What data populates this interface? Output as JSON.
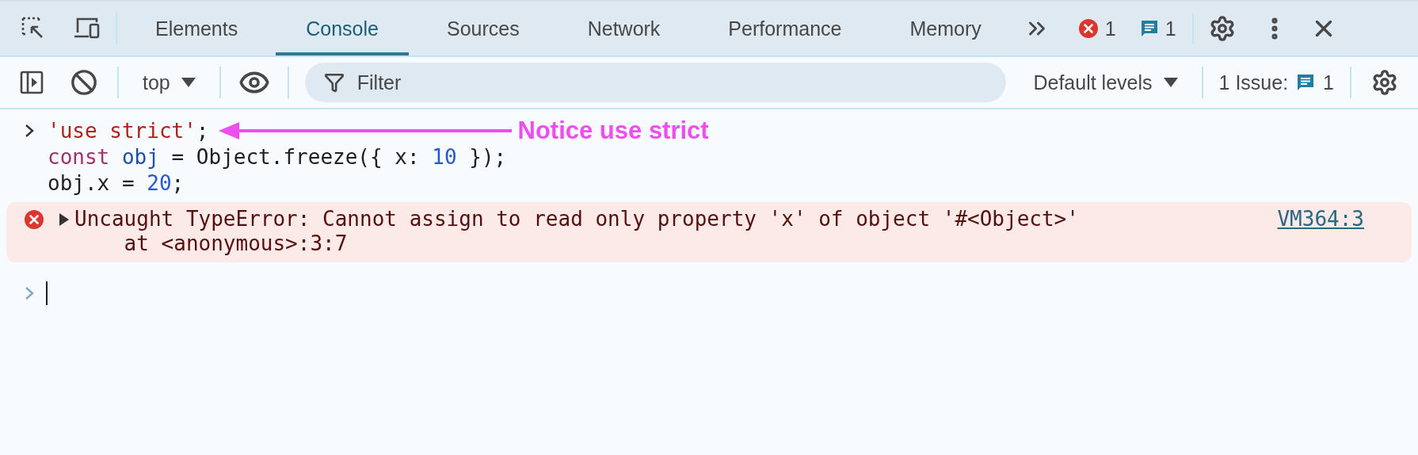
{
  "main_toolbar": {
    "tabs": [
      {
        "label": "Elements",
        "selected": false
      },
      {
        "label": "Console",
        "selected": true
      },
      {
        "label": "Sources",
        "selected": false
      },
      {
        "label": "Network",
        "selected": false
      },
      {
        "label": "Performance",
        "selected": false
      },
      {
        "label": "Memory",
        "selected": false
      }
    ],
    "error_count": "1",
    "message_count": "1"
  },
  "console_toolbar": {
    "context": "top",
    "filter": {
      "placeholder": "Filter"
    },
    "levels": "Default levels",
    "issues": {
      "label": "1 Issue:",
      "count": "1"
    }
  },
  "entries": [
    {
      "kind": "input",
      "annotation": "Notice use strict",
      "lines": [
        [
          {
            "kind": "string",
            "text": "'use strict'"
          },
          {
            "kind": "plain",
            "text": ";"
          }
        ],
        [
          {
            "kind": "keyword",
            "text": "const "
          },
          {
            "kind": "variable",
            "text": "obj"
          },
          {
            "kind": "plain",
            "text": " = Object.freeze({ x: "
          },
          {
            "kind": "number",
            "text": "10"
          },
          {
            "kind": "plain",
            "text": " });"
          }
        ],
        [
          {
            "kind": "plain",
            "text": "obj.x = "
          },
          {
            "kind": "number",
            "text": "20"
          },
          {
            "kind": "plain",
            "text": ";"
          }
        ]
      ]
    },
    {
      "kind": "error",
      "expanded": false,
      "message": "Uncaught TypeError: Cannot assign to read only property 'x' of object '#<Object>'",
      "stack": "    at <anonymous>:3:7",
      "source": "VM364:3"
    }
  ]
}
